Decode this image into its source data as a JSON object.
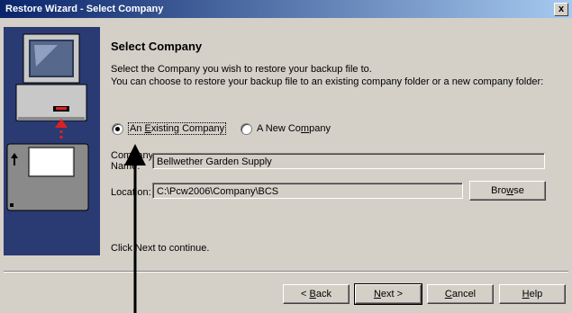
{
  "window": {
    "title": "Restore Wizard - Select Company",
    "close_glyph": "x"
  },
  "header": {
    "title": "Select Company",
    "line1": "Select the Company you wish to restore your backup file to.",
    "line2": "You can choose to restore your backup file to an existing company folder or a new company folder:"
  },
  "options": {
    "existing": {
      "prefix": "An ",
      "accel": "E",
      "suffix": "xisting Company",
      "selected": true
    },
    "new": {
      "prefix": "A New Co",
      "accel": "m",
      "suffix": "pany",
      "selected": false
    }
  },
  "company": {
    "label_line1": "Company",
    "label_line2": "Name:",
    "value": "Bellwether Garden Supply"
  },
  "location": {
    "label": "Location:",
    "value": "C:\\Pcw2006\\Company\\BCS",
    "browse": {
      "prefix": "Bro",
      "accel": "w",
      "suffix": "se"
    }
  },
  "footer_hint": "Click Next to continue.",
  "buttons": {
    "back": {
      "prefix": "< ",
      "accel": "B",
      "suffix": "ack"
    },
    "next": {
      "prefix": "",
      "accel": "N",
      "suffix": "ext >"
    },
    "cancel": {
      "prefix": "",
      "accel": "C",
      "suffix": "ancel"
    },
    "help": {
      "prefix": "",
      "accel": "H",
      "suffix": "elp"
    }
  },
  "colors": {
    "titlebar": "#0a246a",
    "sidebar": "#2a3a72",
    "dialog": "#d4d0c8",
    "accent_arrow": "#e02020"
  },
  "icons": [
    "computer-monitor-icon",
    "desktop-tower-icon",
    "backup-disk-icon",
    "restore-arrow-icon",
    "annotation-arrow-icon"
  ]
}
